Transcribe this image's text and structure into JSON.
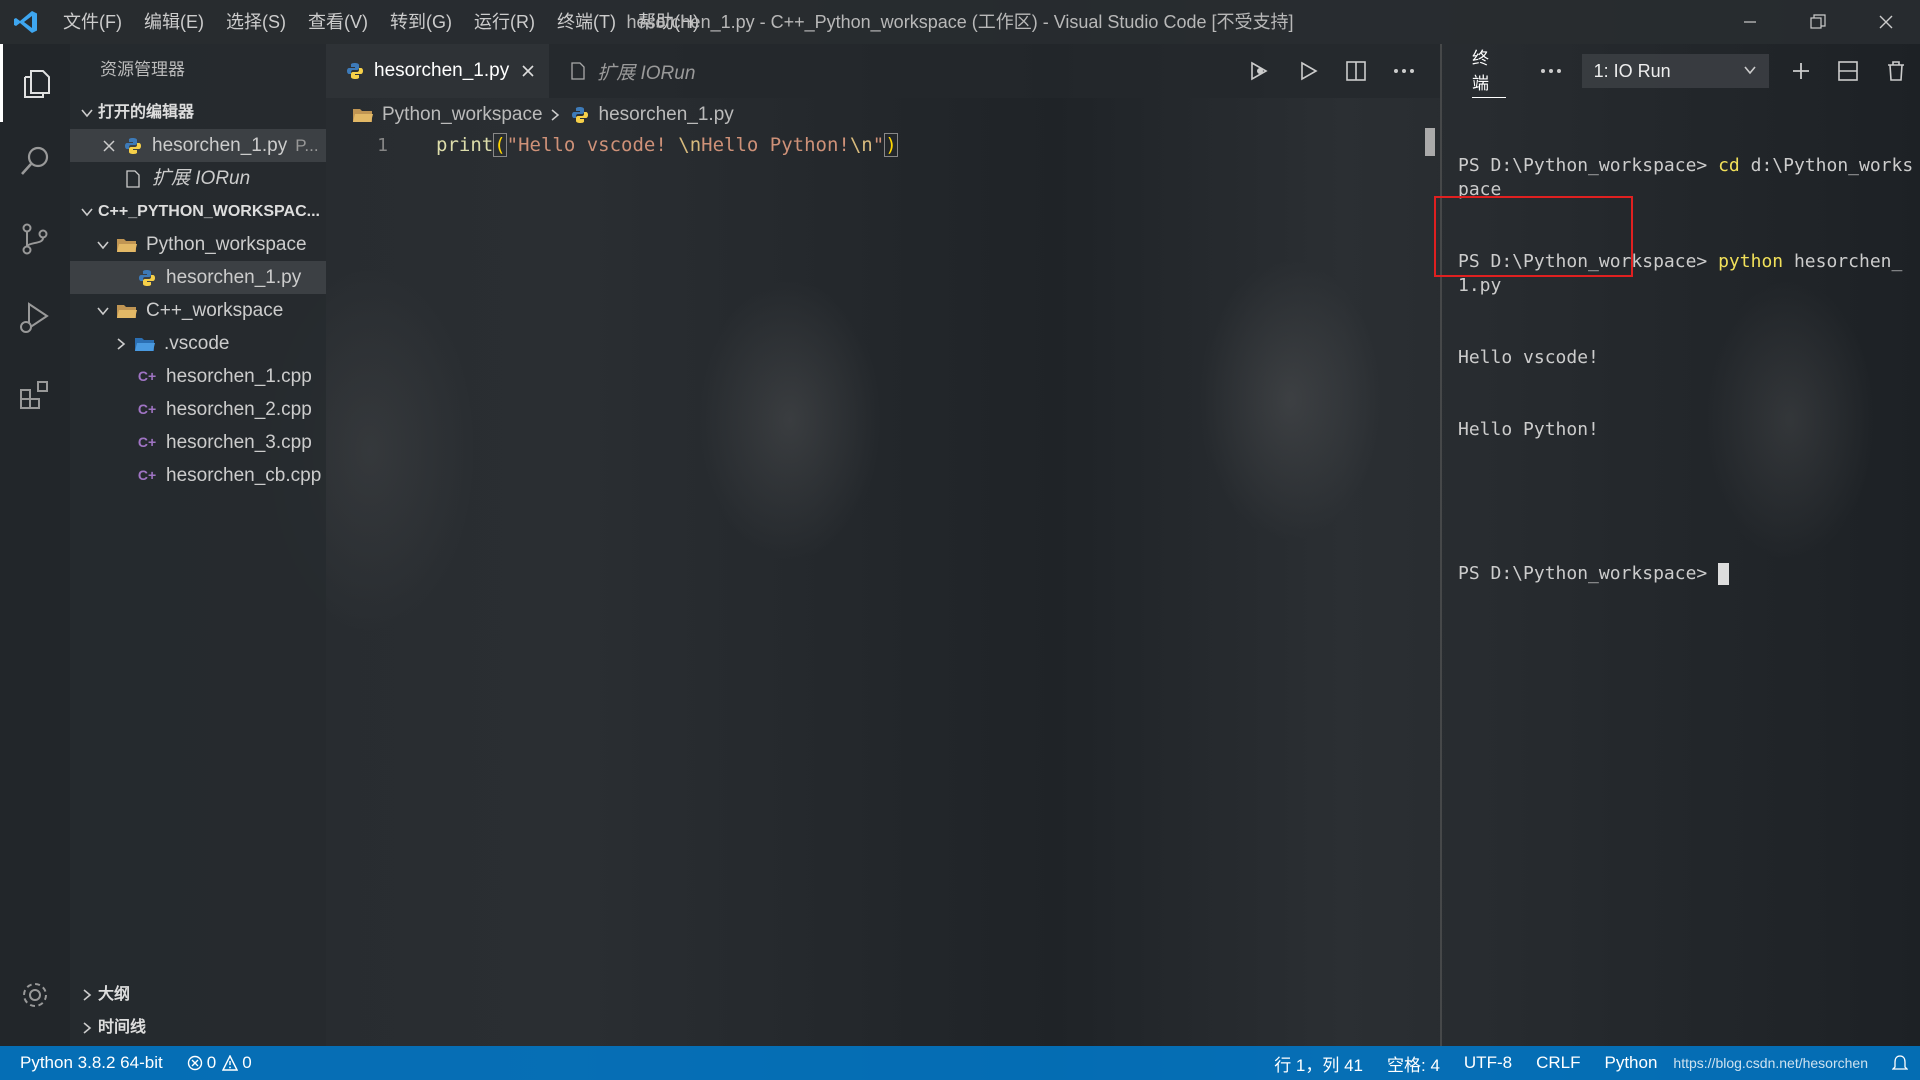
{
  "window": {
    "title": "hesorchen_1.py - C++_Python_workspace (工作区) - Visual Studio Code [不受支持]"
  },
  "menu": [
    "文件(F)",
    "编辑(E)",
    "选择(S)",
    "查看(V)",
    "转到(G)",
    "运行(R)",
    "终端(T)",
    "帮助(H)"
  ],
  "sidebar": {
    "title": "资源管理器",
    "open_editors_label": "打开的编辑器",
    "open_editors": [
      {
        "name": "hesorchen_1.py",
        "desc": "P..."
      },
      {
        "name": "扩展 IORun"
      }
    ],
    "workspace_label": "C++_PYTHON_WORKSPAC...",
    "python_folder": "Python_workspace",
    "python_files": [
      "hesorchen_1.py"
    ],
    "cpp_folder": "C++_workspace",
    "vscode_folder": ".vscode",
    "cpp_files": [
      "hesorchen_1.cpp",
      "hesorchen_2.cpp",
      "hesorchen_3.cpp",
      "hesorchen_cb.cpp"
    ],
    "outline_label": "大纲",
    "timeline_label": "时间线"
  },
  "tabs": [
    {
      "label": "hesorchen_1.py",
      "active": true
    },
    {
      "label": "扩展 IORun",
      "active": false
    }
  ],
  "breadcrumb": [
    "Python_workspace",
    "hesorchen_1.py"
  ],
  "editor": {
    "line_number": "1",
    "code": {
      "fn": "print",
      "open": "(",
      "str1": "\"Hello vscode! ",
      "esc1": "\\n",
      "str2": "Hello Python!",
      "esc2": "\\n",
      "str3": "\"",
      "close": ")"
    }
  },
  "terminal": {
    "tab_label": "终端",
    "selected": "1: IO Run",
    "lines": {
      "prompt1": "PS D:\\Python_workspace> ",
      "cmd1": "cd",
      "arg1": " d:\\Python_workspace",
      "prompt2": "PS D:\\Python_workspace> ",
      "cmd2": "python",
      "arg2": " hesorchen_1.py",
      "out1": "Hello vscode!",
      "out2": "Hello Python!",
      "prompt3": "PS D:\\Python_workspace> "
    }
  },
  "statusbar": {
    "python": "Python 3.8.2 64-bit",
    "errors": "0",
    "warnings": "0",
    "position": "行 1，列 41",
    "spaces": "空格: 4",
    "encoding": "UTF-8",
    "eol": "CRLF",
    "language": "Python",
    "watermark": "https://blog.csdn.net/hesorchen"
  },
  "colors": {
    "accent": "#007acc",
    "highlight_box": "#e02020",
    "python_icon": "#f6d049",
    "cpp_icon": "#a074c4"
  }
}
